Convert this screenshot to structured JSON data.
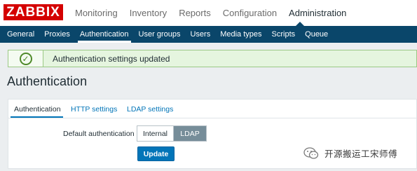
{
  "logo": "ZABBIX",
  "main_menu": [
    "Monitoring",
    "Inventory",
    "Reports",
    "Configuration",
    "Administration"
  ],
  "sub_menu": [
    "General",
    "Proxies",
    "Authentication",
    "User groups",
    "Users",
    "Media types",
    "Scripts",
    "Queue"
  ],
  "message": {
    "text": "Authentication settings updated",
    "icon": "check-circle-icon"
  },
  "page_title": "Authentication",
  "tabs": [
    "Authentication",
    "HTTP settings",
    "LDAP settings"
  ],
  "form": {
    "default_auth_label": "Default authentication",
    "options": [
      "Internal",
      "LDAP"
    ],
    "selected": "LDAP",
    "update_label": "Update"
  },
  "watermark": "开源搬运工宋师傅",
  "colors": {
    "brand_red": "#d40000",
    "nav_blue": "#0a466a",
    "accent_blue": "#0275b8",
    "success_bg": "#e5f5df",
    "selected_toggle": "#768d99"
  }
}
